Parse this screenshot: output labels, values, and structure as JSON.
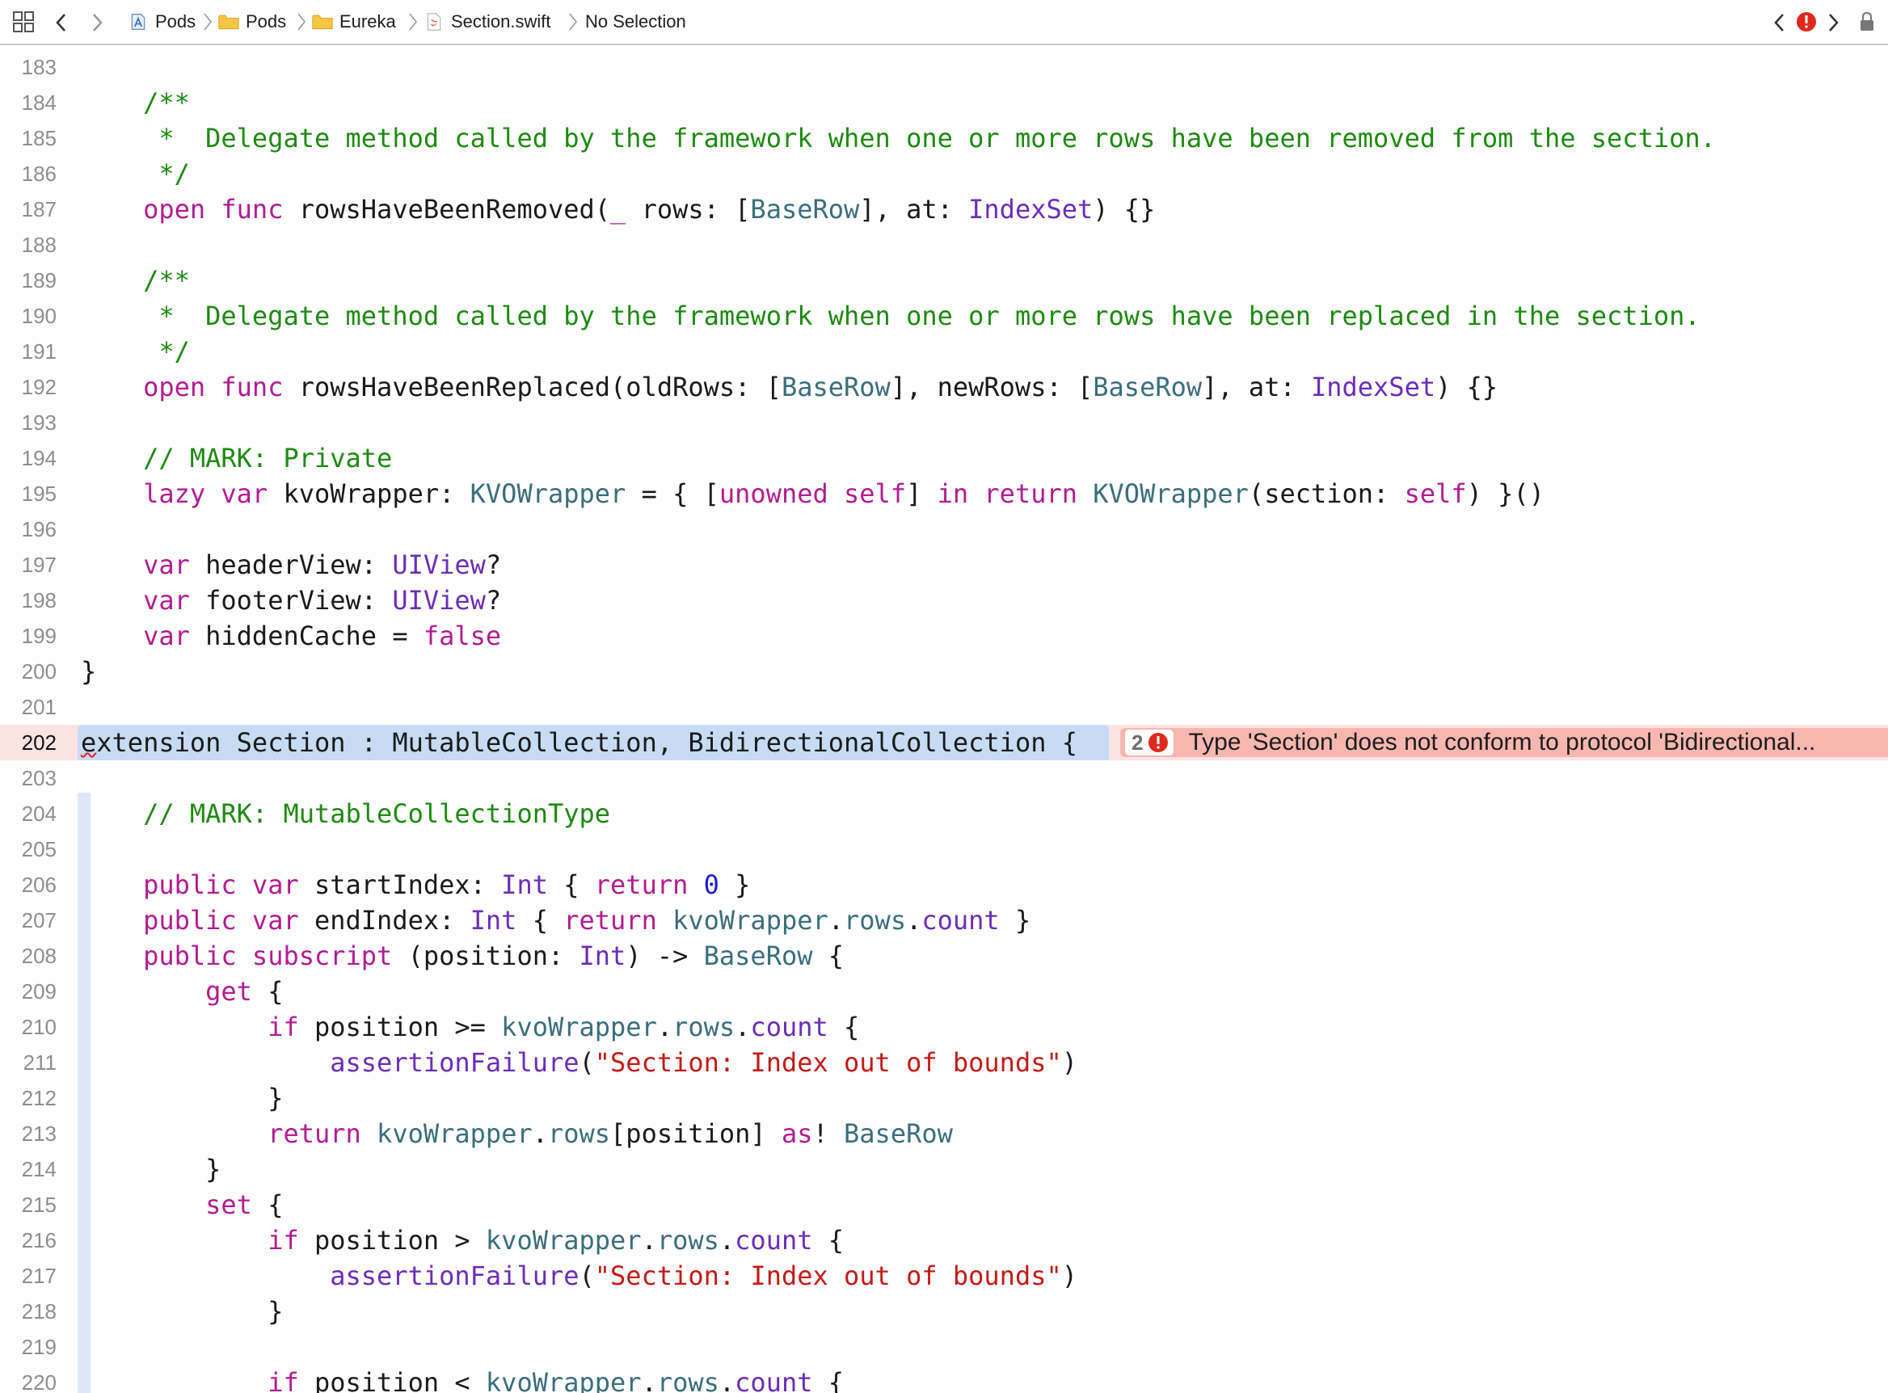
{
  "jumpbar": {
    "breadcrumbs": [
      {
        "label": "Pods",
        "icon": "xcode-project-icon"
      },
      {
        "label": "Pods",
        "icon": "folder-icon"
      },
      {
        "label": "Eureka",
        "icon": "folder-icon"
      },
      {
        "label": "Section.swift",
        "icon": "swift-file-icon"
      },
      {
        "label": "No Selection",
        "icon": ""
      }
    ]
  },
  "issue": {
    "count": "2",
    "message": "Type 'Section' does not conform to protocol 'Bidirectional..."
  },
  "colors": {
    "keyword": "#b21c93",
    "comment": "#1e8a12",
    "builtin_type": "#6a2eb7",
    "project_type": "#3b6e7b",
    "string": "#c41a16",
    "number": "#1f19cc",
    "error_line": "#fbe3e1",
    "error_badge": "#f7b7ae",
    "scope_highlight": "#c7dbf5"
  },
  "code": [
    {
      "num": "183",
      "tokens": []
    },
    {
      "num": "184",
      "tokens": [
        [
          "    ",
          ""
        ],
        [
          "/**",
          "c"
        ]
      ]
    },
    {
      "num": "185",
      "tokens": [
        [
          "    ",
          ""
        ],
        [
          " *  Delegate method called by the framework when one or more rows have been removed from the section.",
          "c"
        ]
      ]
    },
    {
      "num": "186",
      "tokens": [
        [
          "    ",
          ""
        ],
        [
          " */",
          "c"
        ]
      ]
    },
    {
      "num": "187",
      "tokens": [
        [
          "    ",
          ""
        ],
        [
          "open",
          "k"
        ],
        [
          " ",
          ""
        ],
        [
          "func",
          "k"
        ],
        [
          " rowsHaveBeenRemoved(",
          ""
        ],
        [
          "_",
          "k"
        ],
        [
          " rows: [",
          ""
        ],
        [
          "BaseRow",
          "p"
        ],
        [
          "], at: ",
          ""
        ],
        [
          "IndexSet",
          "t"
        ],
        [
          ") {}",
          ""
        ]
      ]
    },
    {
      "num": "188",
      "tokens": []
    },
    {
      "num": "189",
      "tokens": [
        [
          "    ",
          ""
        ],
        [
          "/**",
          "c"
        ]
      ]
    },
    {
      "num": "190",
      "tokens": [
        [
          "    ",
          ""
        ],
        [
          " *  Delegate method called by the framework when one or more rows have been replaced in the section.",
          "c"
        ]
      ]
    },
    {
      "num": "191",
      "tokens": [
        [
          "    ",
          ""
        ],
        [
          " */",
          "c"
        ]
      ]
    },
    {
      "num": "192",
      "tokens": [
        [
          "    ",
          ""
        ],
        [
          "open",
          "k"
        ],
        [
          " ",
          ""
        ],
        [
          "func",
          "k"
        ],
        [
          " rowsHaveBeenReplaced(oldRows: [",
          ""
        ],
        [
          "BaseRow",
          "p"
        ],
        [
          "], newRows: [",
          ""
        ],
        [
          "BaseRow",
          "p"
        ],
        [
          "], at: ",
          ""
        ],
        [
          "IndexSet",
          "t"
        ],
        [
          ") {}",
          ""
        ]
      ]
    },
    {
      "num": "193",
      "tokens": []
    },
    {
      "num": "194",
      "tokens": [
        [
          "    ",
          ""
        ],
        [
          "// MARK: Private",
          "c"
        ]
      ]
    },
    {
      "num": "195",
      "tokens": [
        [
          "    ",
          ""
        ],
        [
          "lazy",
          "k"
        ],
        [
          " ",
          ""
        ],
        [
          "var",
          "k"
        ],
        [
          " kvoWrapper: ",
          ""
        ],
        [
          "KVOWrapper",
          "p"
        ],
        [
          " = { [",
          ""
        ],
        [
          "unowned",
          "k"
        ],
        [
          " ",
          ""
        ],
        [
          "self",
          "k"
        ],
        [
          "] ",
          ""
        ],
        [
          "in",
          "k"
        ],
        [
          " ",
          ""
        ],
        [
          "return",
          "k"
        ],
        [
          " ",
          ""
        ],
        [
          "KVOWrapper",
          "p"
        ],
        [
          "(section: ",
          ""
        ],
        [
          "self",
          "k"
        ],
        [
          ") }()",
          ""
        ]
      ]
    },
    {
      "num": "196",
      "tokens": []
    },
    {
      "num": "197",
      "tokens": [
        [
          "    ",
          ""
        ],
        [
          "var",
          "k"
        ],
        [
          " headerView: ",
          ""
        ],
        [
          "UIView",
          "t"
        ],
        [
          "?",
          ""
        ]
      ]
    },
    {
      "num": "198",
      "tokens": [
        [
          "    ",
          ""
        ],
        [
          "var",
          "k"
        ],
        [
          " footerView: ",
          ""
        ],
        [
          "UIView",
          "t"
        ],
        [
          "?",
          ""
        ]
      ]
    },
    {
      "num": "199",
      "tokens": [
        [
          "    ",
          ""
        ],
        [
          "var",
          "k"
        ],
        [
          " hiddenCache = ",
          ""
        ],
        [
          "false",
          "k"
        ]
      ]
    },
    {
      "num": "200",
      "tokens": [
        [
          "}",
          ""
        ]
      ]
    },
    {
      "num": "201",
      "tokens": []
    },
    {
      "num": "202",
      "tokens": [
        [
          "e",
          "squig"
        ],
        [
          "xtension Section : MutableCollection, BidirectionalCollection {",
          ""
        ]
      ]
    },
    {
      "num": "203",
      "tokens": []
    },
    {
      "num": "204",
      "tokens": [
        [
          "    ",
          ""
        ],
        [
          "// MARK: MutableCollectionType",
          "c"
        ]
      ]
    },
    {
      "num": "205",
      "tokens": []
    },
    {
      "num": "206",
      "tokens": [
        [
          "    ",
          ""
        ],
        [
          "public",
          "k"
        ],
        [
          " ",
          ""
        ],
        [
          "var",
          "k"
        ],
        [
          " startIndex: ",
          ""
        ],
        [
          "Int",
          "t"
        ],
        [
          " { ",
          ""
        ],
        [
          "return",
          "k"
        ],
        [
          " ",
          ""
        ],
        [
          "0",
          "n"
        ],
        [
          " }",
          ""
        ]
      ]
    },
    {
      "num": "207",
      "tokens": [
        [
          "    ",
          ""
        ],
        [
          "public",
          "k"
        ],
        [
          " ",
          ""
        ],
        [
          "var",
          "k"
        ],
        [
          " endIndex: ",
          ""
        ],
        [
          "Int",
          "t"
        ],
        [
          " { ",
          ""
        ],
        [
          "return",
          "k"
        ],
        [
          " ",
          ""
        ],
        [
          "kvoWrapper",
          "p"
        ],
        [
          ".",
          ""
        ],
        [
          "rows",
          "p"
        ],
        [
          ".",
          ""
        ],
        [
          "count",
          "t"
        ],
        [
          " }",
          ""
        ]
      ]
    },
    {
      "num": "208",
      "tokens": [
        [
          "    ",
          ""
        ],
        [
          "public",
          "k"
        ],
        [
          " ",
          ""
        ],
        [
          "subscript",
          "k"
        ],
        [
          " (position: ",
          ""
        ],
        [
          "Int",
          "t"
        ],
        [
          ") -> ",
          ""
        ],
        [
          "BaseRow",
          "p"
        ],
        [
          " {",
          ""
        ]
      ]
    },
    {
      "num": "209",
      "tokens": [
        [
          "        ",
          ""
        ],
        [
          "get",
          "k"
        ],
        [
          " {",
          ""
        ]
      ]
    },
    {
      "num": "210",
      "tokens": [
        [
          "            ",
          ""
        ],
        [
          "if",
          "k"
        ],
        [
          " position >= ",
          ""
        ],
        [
          "kvoWrapper",
          "p"
        ],
        [
          ".",
          ""
        ],
        [
          "rows",
          "p"
        ],
        [
          ".",
          ""
        ],
        [
          "count",
          "t"
        ],
        [
          " {",
          ""
        ]
      ]
    },
    {
      "num": "211",
      "tokens": [
        [
          "                ",
          ""
        ],
        [
          "assertionFailure",
          "t"
        ],
        [
          "(",
          ""
        ],
        [
          "\"Section: Index out of bounds\"",
          "s"
        ],
        [
          ")",
          ""
        ]
      ]
    },
    {
      "num": "212",
      "tokens": [
        [
          "            }",
          ""
        ]
      ]
    },
    {
      "num": "213",
      "tokens": [
        [
          "            ",
          ""
        ],
        [
          "return",
          "k"
        ],
        [
          " ",
          ""
        ],
        [
          "kvoWrapper",
          "p"
        ],
        [
          ".",
          ""
        ],
        [
          "rows",
          "p"
        ],
        [
          "[position] ",
          ""
        ],
        [
          "as",
          "k"
        ],
        [
          "! ",
          ""
        ],
        [
          "BaseRow",
          "p"
        ]
      ]
    },
    {
      "num": "214",
      "tokens": [
        [
          "        }",
          ""
        ]
      ]
    },
    {
      "num": "215",
      "tokens": [
        [
          "        ",
          ""
        ],
        [
          "set",
          "k"
        ],
        [
          " {",
          ""
        ]
      ]
    },
    {
      "num": "216",
      "tokens": [
        [
          "            ",
          ""
        ],
        [
          "if",
          "k"
        ],
        [
          " position > ",
          ""
        ],
        [
          "kvoWrapper",
          "p"
        ],
        [
          ".",
          ""
        ],
        [
          "rows",
          "p"
        ],
        [
          ".",
          ""
        ],
        [
          "count",
          "t"
        ],
        [
          " {",
          ""
        ]
      ]
    },
    {
      "num": "217",
      "tokens": [
        [
          "                ",
          ""
        ],
        [
          "assertionFailure",
          "t"
        ],
        [
          "(",
          ""
        ],
        [
          "\"Section: Index out of bounds\"",
          "s"
        ],
        [
          ")",
          ""
        ]
      ]
    },
    {
      "num": "218",
      "tokens": [
        [
          "            }",
          ""
        ]
      ]
    },
    {
      "num": "219",
      "tokens": []
    },
    {
      "num": "220",
      "tokens": [
        [
          "            ",
          ""
        ],
        [
          "if",
          "k"
        ],
        [
          " position < ",
          ""
        ],
        [
          "kvoWrapper",
          "p"
        ],
        [
          ".",
          ""
        ],
        [
          "rows",
          "p"
        ],
        [
          ".",
          ""
        ],
        [
          "count",
          "t"
        ],
        [
          " {",
          ""
        ]
      ]
    }
  ]
}
